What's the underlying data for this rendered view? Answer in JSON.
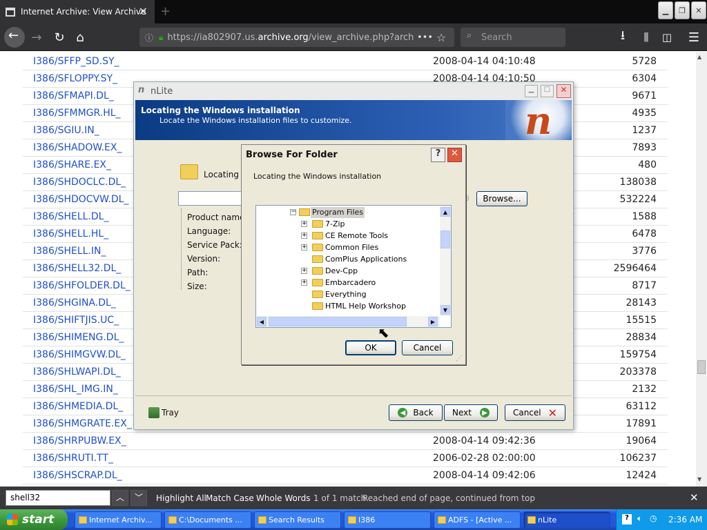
{
  "browser": {
    "tab_title": "Internet Archive: View Archive",
    "url_prefix": "https://ia802907.us.",
    "url_domain": "archive.org",
    "url_path": "/view_archive.php?arch",
    "search_placeholder": "Search"
  },
  "archive_rows": [
    {
      "name": "I386/SFFP_SD.SY_",
      "date": "2008-04-14 04:10:48",
      "size": "5728"
    },
    {
      "name": "I386/SFLOPPY.SY_",
      "date": "2008-04-14 04:10:50",
      "size": "6304"
    },
    {
      "name": "I386/SFMAPI.DL_",
      "date": "",
      "size": "9671"
    },
    {
      "name": "I386/SFMMGR.HL_",
      "date": "",
      "size": "4935"
    },
    {
      "name": "I386/SGIU.IN_",
      "date": "",
      "size": "1237"
    },
    {
      "name": "I386/SHADOW.EX_",
      "date": "",
      "size": "7893"
    },
    {
      "name": "I386/SHARE.EX_",
      "date": "",
      "size": "480"
    },
    {
      "name": "I386/SHDOCLC.DL_",
      "date": "",
      "size": "138038"
    },
    {
      "name": "I386/SHDOCVW.DL_",
      "date": "",
      "size": "532224"
    },
    {
      "name": "I386/SHELL.DL_",
      "date": "",
      "size": "1588"
    },
    {
      "name": "I386/SHELL.HL_",
      "date": "",
      "size": "6478"
    },
    {
      "name": "I386/SHELL.IN_",
      "date": "",
      "size": "3776"
    },
    {
      "name": "I386/SHELL32.DL_",
      "date": "",
      "size": "2596464"
    },
    {
      "name": "I386/SHFOLDER.DL_",
      "date": "",
      "size": "8717"
    },
    {
      "name": "I386/SHGINA.DL_",
      "date": "",
      "size": "28143"
    },
    {
      "name": "I386/SHIFTJIS.UC_",
      "date": "",
      "size": "15515"
    },
    {
      "name": "I386/SHIMENG.DL_",
      "date": "",
      "size": "28834"
    },
    {
      "name": "I386/SHIMGVW.DL_",
      "date": "",
      "size": "159754"
    },
    {
      "name": "I386/SHLWAPI.DL_",
      "date": "",
      "size": "203378"
    },
    {
      "name": "I386/SHL_IMG.IN_",
      "date": "",
      "size": "2132"
    },
    {
      "name": "I386/SHMEDIA.DL_",
      "date": "",
      "size": "63112"
    },
    {
      "name": "I386/SHMGRATE.EX_",
      "date": "",
      "size": "17891"
    },
    {
      "name": "I386/SHRPUBW.EX_",
      "date": "2008-04-14 09:42:36",
      "size": "19064"
    },
    {
      "name": "I386/SHRUTI.TT_",
      "date": "2006-02-28 02:00:00",
      "size": "106237"
    },
    {
      "name": "I386/SHSCRAP.DL_",
      "date": "2008-04-14 09:42:06",
      "size": "12424"
    }
  ],
  "findbar": {
    "query": "shell32",
    "highlight_all": "Highlight All",
    "match_case": "Match Case",
    "whole_words": "Whole Words",
    "count": "1 of 1 match",
    "status": "Reached end of page, continued from top"
  },
  "nlite": {
    "title": "nLite",
    "header_title": "Locating the Windows installation",
    "header_subtitle": "Locate the Windows installation files to customize.",
    "locating_label": "Locating th",
    "browse_button": "Browse...",
    "fields": [
      "Product name:",
      "Language:",
      "Service Pack:",
      "Version:",
      "Path:",
      "Size:"
    ],
    "tray_label": "Tray",
    "back_button": "Back",
    "next_button": "Next",
    "cancel_button": "Cancel"
  },
  "browse_dialog": {
    "title": "Browse For Folder",
    "help_button": "?",
    "description": "Locating the Windows installation",
    "selected_folder": "Program Files",
    "folders": [
      {
        "name": "7-Zip",
        "expandable": true
      },
      {
        "name": "CE Remote Tools",
        "expandable": true
      },
      {
        "name": "Common Files",
        "expandable": true
      },
      {
        "name": "ComPlus Applications",
        "expandable": false
      },
      {
        "name": "Dev-Cpp",
        "expandable": true
      },
      {
        "name": "Embarcadero",
        "expandable": true
      },
      {
        "name": "Everything",
        "expandable": false
      },
      {
        "name": "HTML Help Workshop",
        "expandable": false
      }
    ],
    "ok_button": "OK",
    "cancel_button": "Cancel"
  },
  "taskbar": {
    "start_label": "start",
    "items": [
      "Internet Archiv...",
      "C:\\Documents ...",
      "Search Results",
      "I386",
      "ADFS - [Active ...",
      "nLite"
    ],
    "clock": "2:36 AM"
  },
  "colors": {
    "link": "#1f4fd2",
    "firefox_dark": "#323234",
    "xp_taskbar": "#2157d9",
    "nlite_header": "#0a3b83"
  }
}
